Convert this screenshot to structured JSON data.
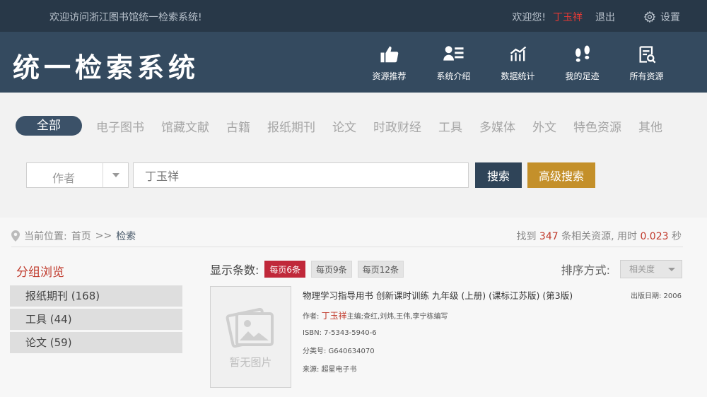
{
  "topbar": {
    "welcome": "欢迎访问浙江图书馆统一检索系统!",
    "greeting": "欢迎您!",
    "username": "丁玉祥",
    "logout": "退出",
    "settings": "设置"
  },
  "header": {
    "logo": "统一检索系统",
    "nav": [
      {
        "label": "资源推荐",
        "icon": "thumbs-up-icon"
      },
      {
        "label": "系统介绍",
        "icon": "id-card-icon"
      },
      {
        "label": "数据统计",
        "icon": "bar-chart-icon"
      },
      {
        "label": "我的足迹",
        "icon": "footprints-icon"
      },
      {
        "label": "所有资源",
        "icon": "resource-search-icon"
      }
    ]
  },
  "categories": [
    "全部",
    "电子图书",
    "馆藏文献",
    "古籍",
    "报纸期刊",
    "论文",
    "时政财经",
    "工具",
    "多媒体",
    "外文",
    "特色资源",
    "其他"
  ],
  "search": {
    "field": "作者",
    "query": "丁玉祥",
    "search_label": "搜索",
    "advanced_label": "高级搜索"
  },
  "breadcrumb": {
    "prefix": "当前位置:",
    "home": "首页",
    "sep": ">>",
    "current": "检索"
  },
  "result": {
    "found_prefix": "找到",
    "count": "347",
    "found_suffix": "条相关资源,",
    "time_prefix": "用时",
    "time": "0.023",
    "time_suffix": "秒"
  },
  "groups": {
    "title": "分组浏览",
    "items": [
      "报纸期刊 (168)",
      "工具 (44)",
      "论文 (59)"
    ]
  },
  "pagesize": {
    "label": "显示条数:",
    "options": [
      "每页6条",
      "每页9条",
      "每页12条"
    ],
    "selected": 0
  },
  "sort": {
    "label": "排序方式:",
    "value": "相关度"
  },
  "book": {
    "cover_text": "暂无图片",
    "title": "物理学习指导用书 创新课时训练 九年级 (上册) (课标江苏版) (第3版)",
    "pubdate_label": "出版日期:",
    "pubdate": "2006",
    "author_label": "作者:",
    "author": "丁玉祥",
    "author_rest": "主编;查红,刘炜,王伟,李宁栋编写",
    "isbn": "ISBN: 7-5343-5940-6",
    "classno": "分类号: G640634070",
    "source": "来源: 超星电子书"
  },
  "colors": {
    "topbar": "#283848",
    "header": "#344a5f",
    "accent_red": "#c0392b",
    "adv_button": "#c4902a"
  }
}
